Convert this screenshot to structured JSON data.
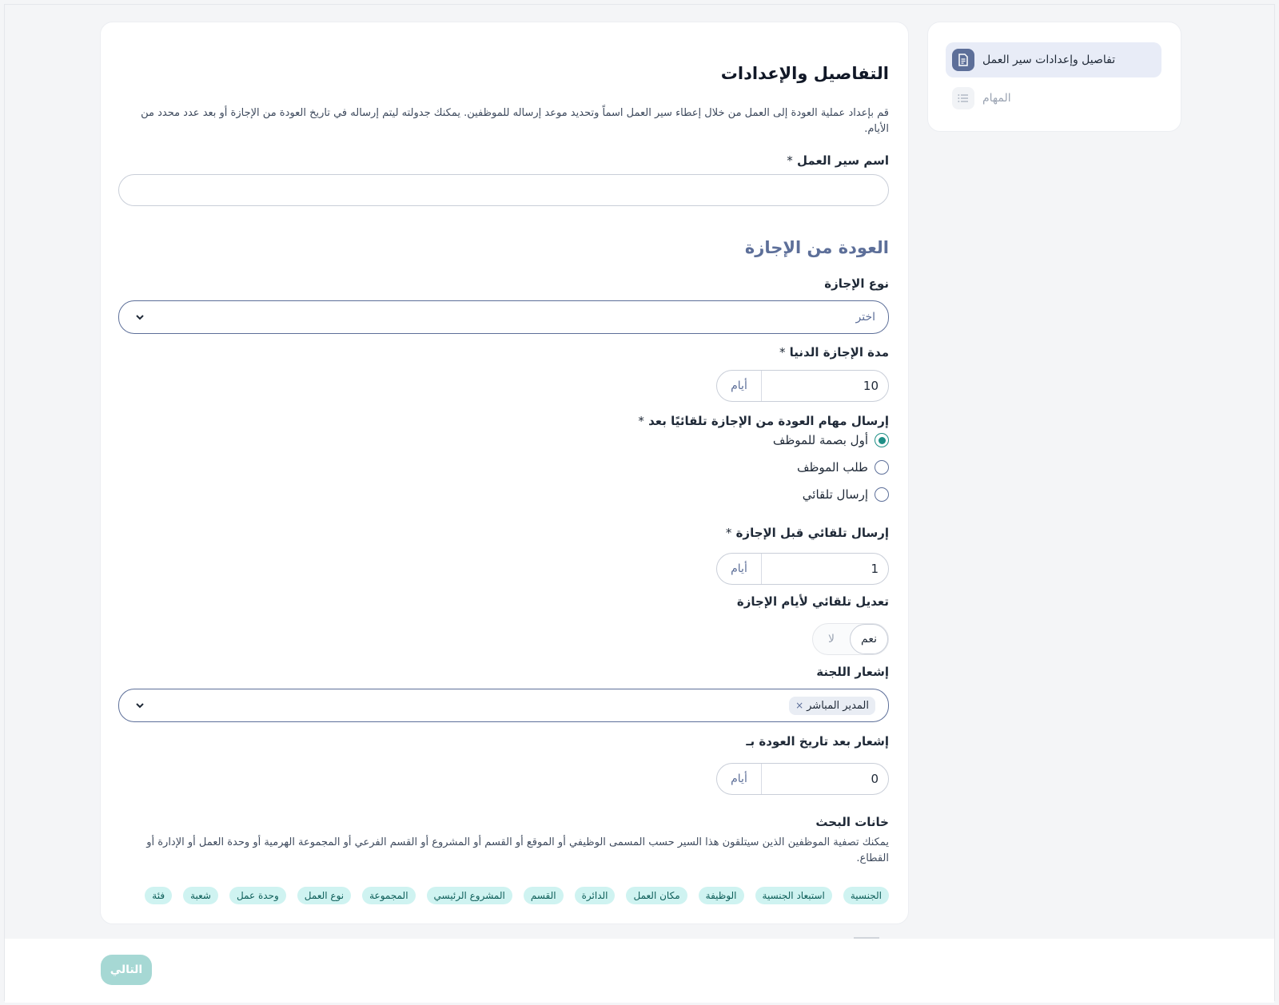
{
  "sidebar": {
    "items": [
      {
        "label": "تفاصيل وإعدادات سير العمل",
        "icon": "document-icon",
        "active": true
      },
      {
        "label": "المهام",
        "icon": "list-icon",
        "active": false
      }
    ]
  },
  "main": {
    "title": "التفاصيل والإعدادات",
    "description": "قم بإعداد عملية العودة إلى العمل من خلال إعطاء سير العمل اسماً وتحديد موعد إرساله للموظفين. يمكنك جدولته ليتم إرساله في تاريخ العودة من الإجازة أو بعد عدد محدد من الأيام.",
    "workflow_name": {
      "label": "اسم سير العمل",
      "required_mark": "*",
      "value": ""
    },
    "section_title": "العودة من الإجازة",
    "leave_type": {
      "label": "نوع الإجازة",
      "placeholder": "اختر"
    },
    "min_leave": {
      "label": "مدة الإجازة الدنيا",
      "required_mark": "*",
      "value": "10",
      "unit": "أيام"
    },
    "send_after": {
      "label": "إرسال مهام العودة من الإجازة تلقائيًا بعد",
      "required_mark": "*",
      "options": [
        {
          "label": "أول بصمة للموظف",
          "checked": true
        },
        {
          "label": "طلب الموظف",
          "checked": false
        },
        {
          "label": "إرسال تلقائي",
          "checked": false
        }
      ]
    },
    "auto_before": {
      "label": "إرسال تلقائي قبل الإجازة",
      "required_mark": "*",
      "value": "1",
      "unit": "أيام"
    },
    "auto_adjust": {
      "label": "تعديل تلقائي لأيام الإجازة",
      "yes": "نعم",
      "no": "لا",
      "selected": "yes"
    },
    "committee": {
      "label": "إشعار اللجنة",
      "chip": "المدير المباشر",
      "chip_remove": "×"
    },
    "notify_after": {
      "label": "إشعار بعد تاريخ العودة بـ",
      "value": "0",
      "unit": "أيام"
    },
    "search_fields": {
      "label": "خانات البحث",
      "description": "يمكنك تصفية الموظفين الذين سيتلقون هذا السير حسب المسمى الوظيفي أو الموقع أو القسم أو المشروع أو القسم الفرعي أو المجموعة الهرمية أو وحدة العمل أو الإدارة أو القطاع.",
      "tags": [
        "الجنسية",
        "استبعاد الجنسية",
        "الوظيفة",
        "مكان العمل",
        "الدائرة",
        "القسم",
        "المشروع الرئيسي",
        "المجموعة",
        "نوع العمل",
        "وحدة عمل",
        "شعبة",
        "فئة"
      ]
    }
  },
  "footer": {
    "next_label": "التالي"
  },
  "colors": {
    "accent": "#5d6f99",
    "teal": "#1e8f86",
    "tag_bg": "#cff3f1",
    "next_btn": "#a6d8d4"
  }
}
